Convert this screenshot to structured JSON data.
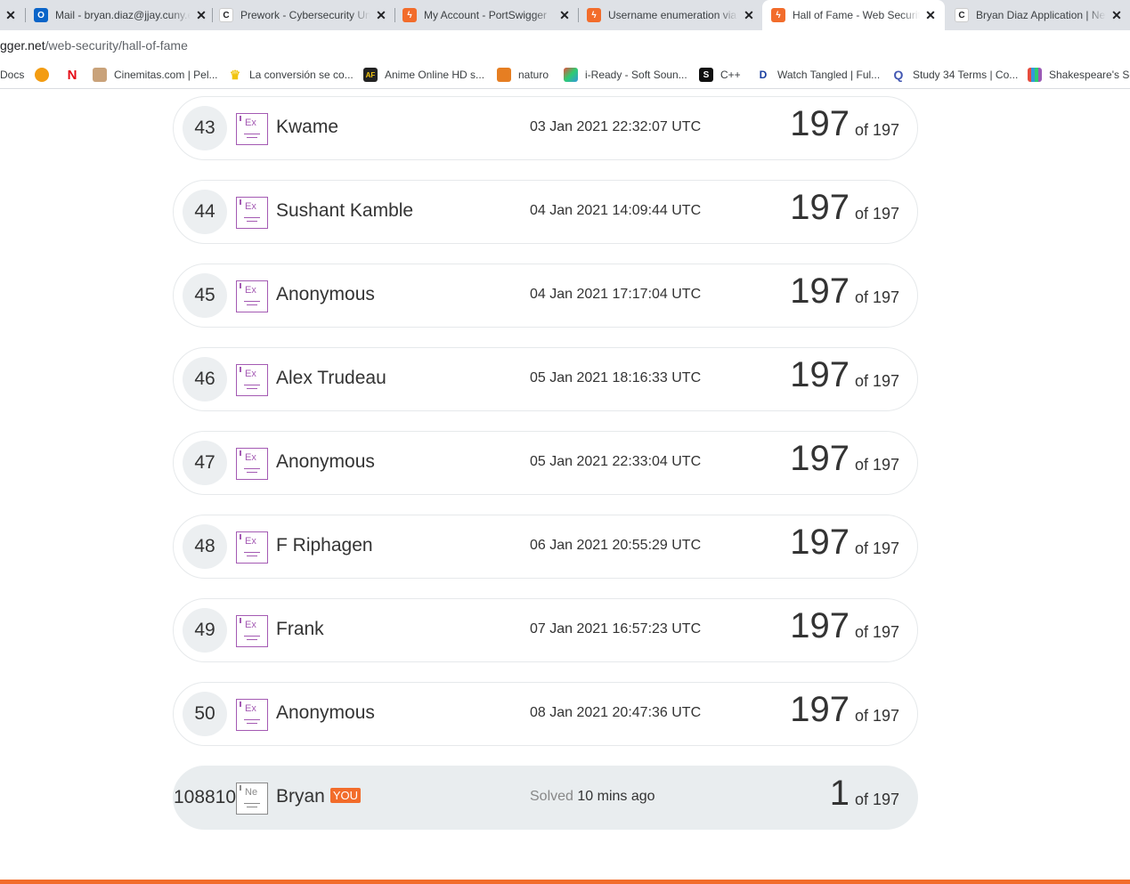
{
  "tabs": [
    {
      "title": "",
      "icon": "close-icon"
    },
    {
      "title": "Mail - bryan.diaz@jjay.cuny.edu",
      "icon": "outlook-icon"
    },
    {
      "title": "Prework - Cybersecurity University",
      "icon": "codepath-icon"
    },
    {
      "title": "My Account - PortSwigger",
      "icon": "portswigger-icon"
    },
    {
      "title": "Username enumeration via different responses",
      "icon": "portswigger-icon"
    },
    {
      "title": "Hall of Fame - Web Security Academy",
      "icon": "portswigger-icon"
    },
    {
      "title": "Bryan Diaz Application | New",
      "icon": "codepath-icon"
    }
  ],
  "address": {
    "host": "gger.net",
    "path": "/web-security/hall-of-fame"
  },
  "bookmarks": [
    {
      "label": "Docs",
      "icon": "docs-icon"
    },
    {
      "label": "",
      "icon": "orange-ball-icon"
    },
    {
      "label": "",
      "icon": "netflix-icon"
    },
    {
      "label": "Cinemitas.com | Pel...",
      "icon": "cinema-icon"
    },
    {
      "label": "La conversión se co...",
      "icon": "crown-icon"
    },
    {
      "label": "Anime Online HD s...",
      "icon": "af-icon"
    },
    {
      "label": "naturo",
      "icon": "naruto-icon"
    },
    {
      "label": "i-Ready - Soft Soun...",
      "icon": "cube-icon"
    },
    {
      "label": "C++",
      "icon": "s-icon"
    },
    {
      "label": "Watch Tangled | Ful...",
      "icon": "disney-icon"
    },
    {
      "label": "Study 34 Terms | Co...",
      "icon": "quizlet-icon"
    },
    {
      "label": "Shakespeare's So",
      "icon": "bars-icon"
    }
  ],
  "leaderboard": {
    "rows": [
      {
        "rank": "43",
        "level": "Ex",
        "name": "Kwame",
        "date": "03 Jan 2021 22:32:07 UTC",
        "score": "197",
        "of": "of 197"
      },
      {
        "rank": "44",
        "level": "Ex",
        "name": "Sushant Kamble",
        "date": "04 Jan 2021 14:09:44 UTC",
        "score": "197",
        "of": "of 197"
      },
      {
        "rank": "45",
        "level": "Ex",
        "name": "Anonymous",
        "date": "04 Jan 2021 17:17:04 UTC",
        "score": "197",
        "of": "of 197"
      },
      {
        "rank": "46",
        "level": "Ex",
        "name": "Alex Trudeau",
        "date": "05 Jan 2021 18:16:33 UTC",
        "score": "197",
        "of": "of 197"
      },
      {
        "rank": "47",
        "level": "Ex",
        "name": "Anonymous",
        "date": "05 Jan 2021 22:33:04 UTC",
        "score": "197",
        "of": "of 197"
      },
      {
        "rank": "48",
        "level": "Ex",
        "name": "F Riphagen",
        "date": "06 Jan 2021 20:55:29 UTC",
        "score": "197",
        "of": "of 197"
      },
      {
        "rank": "49",
        "level": "Ex",
        "name": "Frank",
        "date": "07 Jan 2021 16:57:23 UTC",
        "score": "197",
        "of": "of 197"
      },
      {
        "rank": "50",
        "level": "Ex",
        "name": "Anonymous",
        "date": "08 Jan 2021 20:47:36 UTC",
        "score": "197",
        "of": "of 197"
      }
    ],
    "me": {
      "rank": "108810",
      "level": "Ne",
      "name": "Bryan",
      "you": "YOU",
      "solved_label": "Solved",
      "solved_ago": "10 mins ago",
      "score": "1",
      "of": "of 197"
    }
  },
  "colors": {
    "accent": "#f26c2b",
    "expert_badge": "#a45ab3",
    "novice_badge": "#8a8a8a",
    "row_me_bg": "#e9edef"
  }
}
